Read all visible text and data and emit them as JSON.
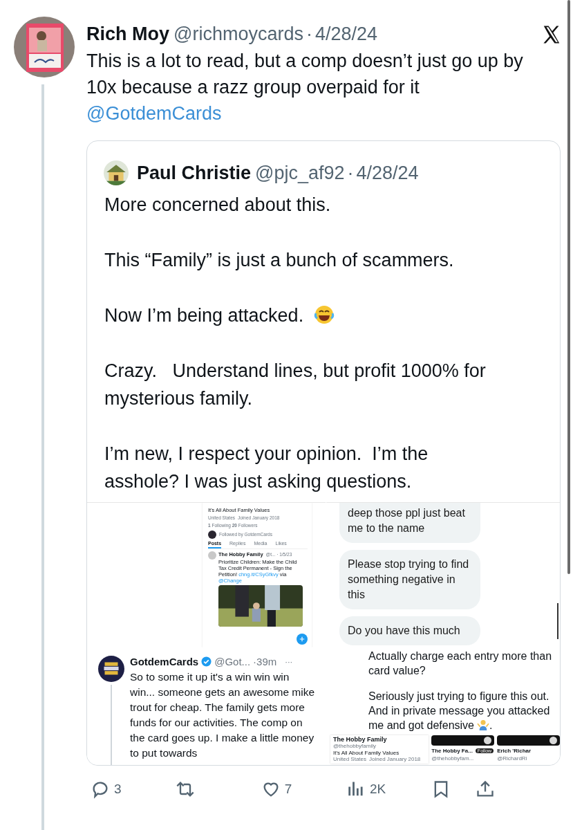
{
  "post": {
    "author": "Rich Moy",
    "handle": "@richmoycards",
    "separator": "·",
    "date": "4/28/24",
    "text": "This is a lot to read, but a comp doesn’t just go up by 10x because a razz group overpaid for it",
    "mention": "@GotdemCards"
  },
  "quote": {
    "author": "Paul Christie",
    "handle": "@pjc_af92",
    "separator": "·",
    "date": "4/28/24",
    "paragraphs": [
      {
        "kind": "text",
        "text": "More concerned about this."
      },
      {
        "kind": "text",
        "text": "This “Family” is just a bunch of scammers."
      },
      {
        "kind": "emoji",
        "text": "Now I’m being attacked.  "
      },
      {
        "kind": "text",
        "text": "Crazy.   Understand lines, but profit 1000% for mysterious family."
      },
      {
        "kind": "text",
        "text": "I’m new, I respect your opinion.  I’m the asshole? I was just asking questions."
      }
    ]
  },
  "media": [
    {
      "kind": "profile",
      "bio": "It's All About Family Values",
      "location": "United States",
      "joined": "Joined January 2018",
      "follows": "**1** Following **20** Followers",
      "followed_by": "Followed by GotdemCards",
      "tabs": [
        {
          "label": "Posts",
          "selected": true
        },
        {
          "label": "Replies",
          "selected": false
        },
        {
          "label": "Media",
          "selected": false
        },
        {
          "label": "Likes",
          "selected": false
        }
      ],
      "tweet": {
        "author": "The Hobby Family",
        "meta": "@t... · 1/5/23",
        "parts": [
          {
            "text": "Prioritize Children: Make the Child Tax Credit Permanent - Sign the Petition! "
          },
          {
            "text": "chng.it/CSyGfkvy",
            "link": true
          },
          {
            "text": " via "
          },
          {
            "text": "@Change",
            "link": true
          }
        ]
      }
    },
    {
      "kind": "chat",
      "bubbles": [
        "deep those ppl just beat me to the name",
        "Please stop trying to find something negative in this",
        "Do you have this much"
      ]
    },
    {
      "kind": "tweet",
      "author": "GotdemCards",
      "verified": true,
      "handle": "@Got...",
      "time": "·39m",
      "more": "···",
      "text": "So to some it up it's a win win win win... someone gets an awesome mike trout for cheap. The family gets more funds for our activities. The comp on the card goes up. I make a little money to put towards"
    },
    {
      "kind": "text",
      "paragraphs": [
        {
          "kind": "text",
          "text": "Actually charge each entry more than card value?"
        },
        {
          "kind": "emoji",
          "text": "Seriously just trying to figure this out.  And in private message you attacked me and got defensive",
          "tail": "."
        }
      ],
      "profile": {
        "name": "The Hobby Family",
        "handle": "@thehobbyfamily",
        "bio": "It's All About Family Values",
        "location": "United States",
        "joined": "Joined January 2018"
      },
      "cards": [
        {
          "name": "The Hobby Fa...",
          "handle": "@thehobbyfam...",
          "button": "Follow"
        },
        {
          "name": "Erich 'Richar",
          "handle": "@RichardRi"
        }
      ]
    }
  ],
  "actions": [
    {
      "kind": "reply",
      "count": "3"
    },
    {
      "kind": "repost"
    },
    {
      "kind": "like",
      "count": "7"
    },
    {
      "kind": "views",
      "count": "2K"
    },
    {
      "kind": "bookmark"
    },
    {
      "kind": "share"
    }
  ]
}
